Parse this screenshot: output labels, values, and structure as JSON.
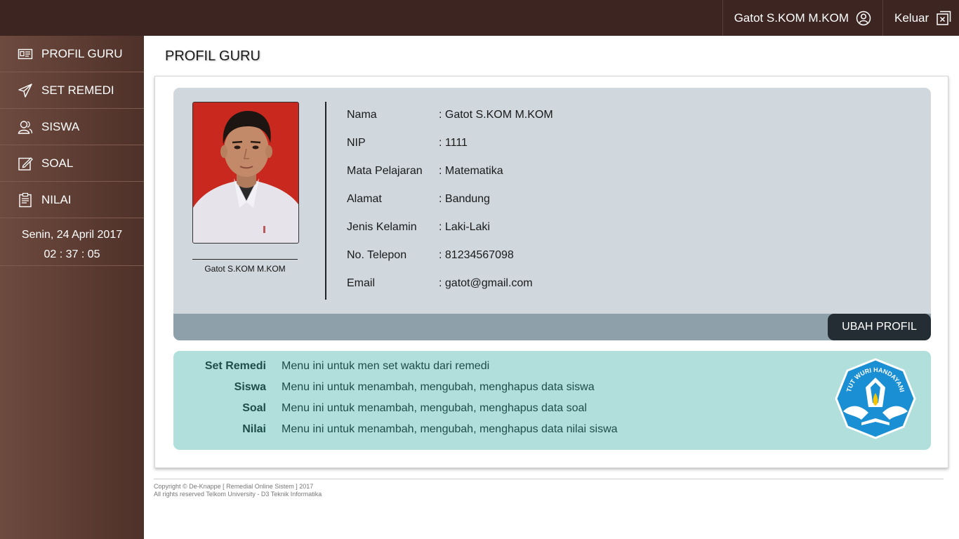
{
  "header": {
    "user_name": "Gatot S.KOM M.KOM",
    "logout_label": "Keluar",
    "user_icon": "user-circle-icon",
    "logout_icon": "close-box-icon"
  },
  "sidebar": {
    "items": [
      {
        "label": "PROFIL GURU",
        "icon": "id-card-icon"
      },
      {
        "label": "SET REMEDI",
        "icon": "paper-plane-icon"
      },
      {
        "label": "SISWA",
        "icon": "users-icon"
      },
      {
        "label": "SOAL",
        "icon": "edit-icon"
      },
      {
        "label": "NILAI",
        "icon": "clipboard-icon"
      }
    ],
    "date": "Senin, 24 April 2017",
    "time": "02 : 37 : 05"
  },
  "page": {
    "title": "PROFIL GURU"
  },
  "profile": {
    "photo_caption": "Gatot S.KOM M.KOM",
    "fields": [
      {
        "label": "Nama",
        "value": ": Gatot S.KOM M.KOM"
      },
      {
        "label": "NIP",
        "value": ": 1111"
      },
      {
        "label": "Mata Pelajaran",
        "value": ": Matematika"
      },
      {
        "label": "Alamat",
        "value": ": Bandung"
      },
      {
        "label": "Jenis Kelamin",
        "value": ": Laki-Laki"
      },
      {
        "label": "No. Telepon",
        "value": ": 81234567098"
      },
      {
        "label": "Email",
        "value": ": gatot@gmail.com"
      }
    ],
    "edit_button": "UBAH PROFIL"
  },
  "help": {
    "rows": [
      {
        "key": "Set Remedi",
        "desc": "Menu ini untuk men set waktu dari remedi"
      },
      {
        "key": "Siswa",
        "desc": "Menu ini untuk menambah, mengubah, menghapus data siswa"
      },
      {
        "key": "Soal",
        "desc": "Menu ini untuk menambah, mengubah, menghapus data soal"
      },
      {
        "key": "Nilai",
        "desc": "Menu ini untuk menambah, mengubah, menghapus data nilai siswa"
      }
    ],
    "logo_text": "TUT WURI HANDAYANI"
  },
  "footer": {
    "line1": "Copyright © De-Knappe [ Remedial Online Sistem ] 2017",
    "line2": "All rights reserved Telkom University - D3 Teknik Informatika"
  },
  "colors": {
    "topbar": "#3d2521",
    "sidebar": "#5e3d33",
    "profile_card": "#d0d7dd",
    "help_card": "#b1dfdc",
    "button": "#232d33"
  }
}
